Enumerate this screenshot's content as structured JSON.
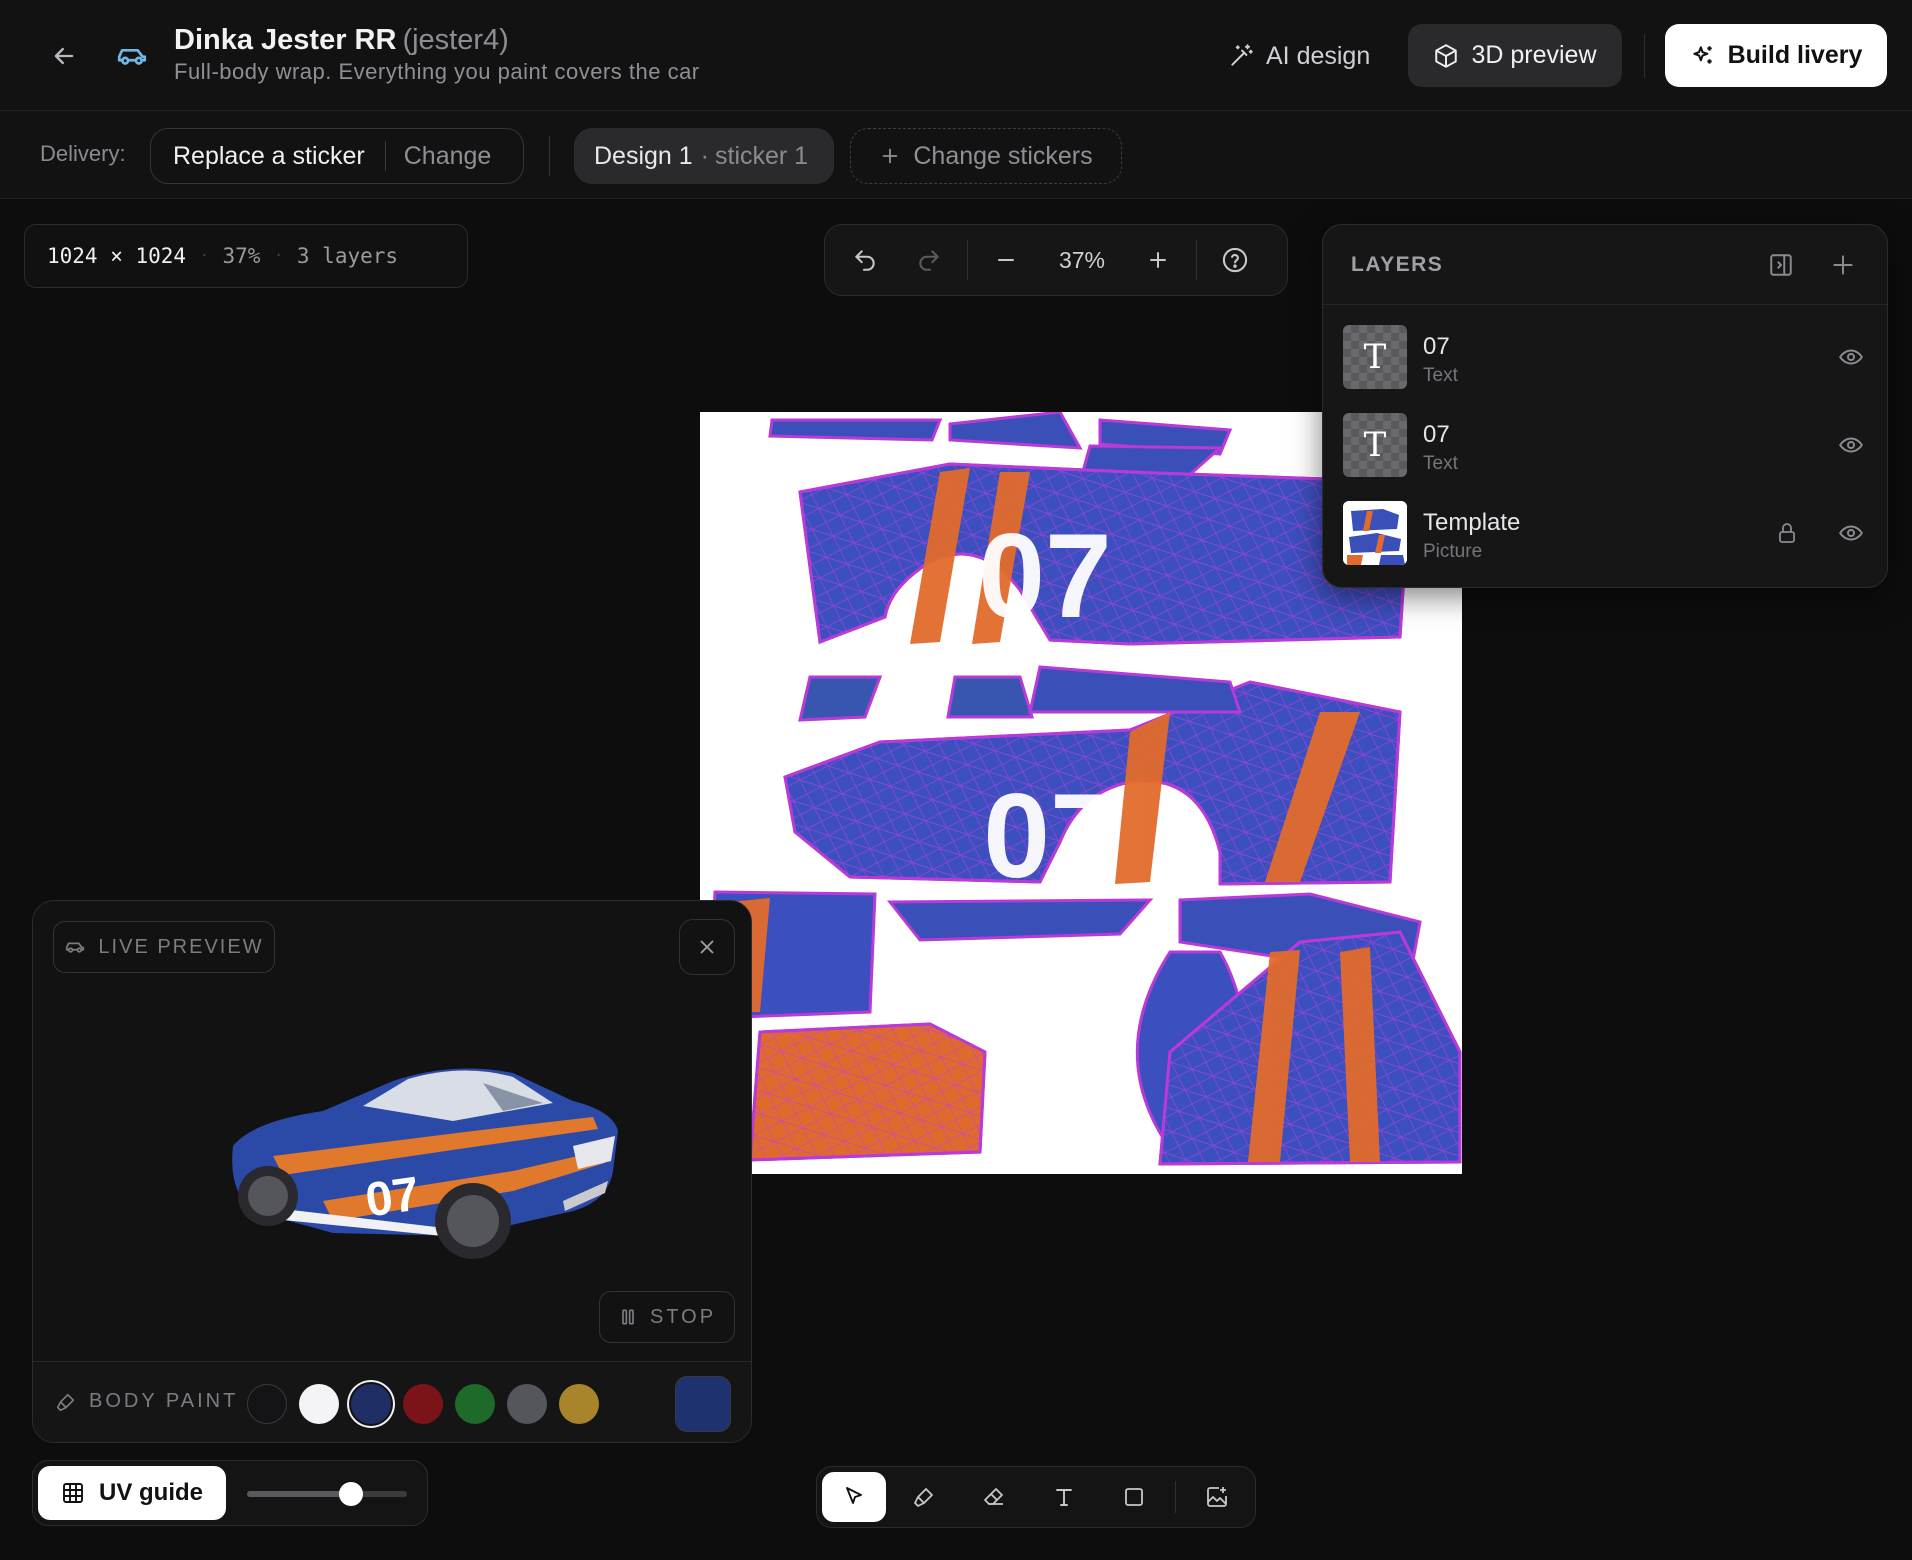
{
  "header": {
    "car_name": "Dinka Jester RR",
    "car_code": "(jester4)",
    "subtitle": "Full-body wrap. Everything you paint covers the car",
    "ai_design_label": "AI design",
    "preview_3d_label": "3D preview",
    "build_label": "Build livery"
  },
  "delivery": {
    "label": "Delivery:",
    "value": "Replace a sticker",
    "change_label": "Change",
    "design_name": "Design 1",
    "design_sep": "·",
    "design_sticker": "sticker 1",
    "change_stickers_label": "Change stickers"
  },
  "canvas_info": {
    "size": "1024 × 1024",
    "sep": "·",
    "zoom": "37%",
    "layers": "3 layers"
  },
  "zoom_bar": {
    "value": "37%"
  },
  "layers_panel": {
    "title": "LAYERS",
    "items": [
      {
        "name": "07",
        "type": "Text",
        "icon": "text-layer-icon",
        "locked": false,
        "visible": true
      },
      {
        "name": "07",
        "type": "Text",
        "icon": "text-layer-icon",
        "locked": false,
        "visible": true
      },
      {
        "name": "Template",
        "type": "Picture",
        "icon": "picture-layer-icon",
        "locked": true,
        "visible": true
      }
    ]
  },
  "uv_texture": {
    "decal_text": "07"
  },
  "live_preview": {
    "badge": "LIVE PREVIEW",
    "stop_label": "STOP",
    "car_number": "07",
    "body_paint_label": "BODY PAINT",
    "swatches": [
      "#141416",
      "#f4f4f6",
      "#1f2f66",
      "#7a1418",
      "#1d6a2a",
      "#55565b",
      "#a8852a"
    ],
    "selected_swatch": 2,
    "custom_color": "#1f3270"
  },
  "uv_guide": {
    "label": "UV guide",
    "opacity": 0.65
  },
  "tools": {
    "active": "select",
    "items": [
      "select-tool",
      "brush-tool",
      "eraser-tool",
      "text-tool",
      "rectangle-tool",
      "add-image-tool"
    ]
  }
}
